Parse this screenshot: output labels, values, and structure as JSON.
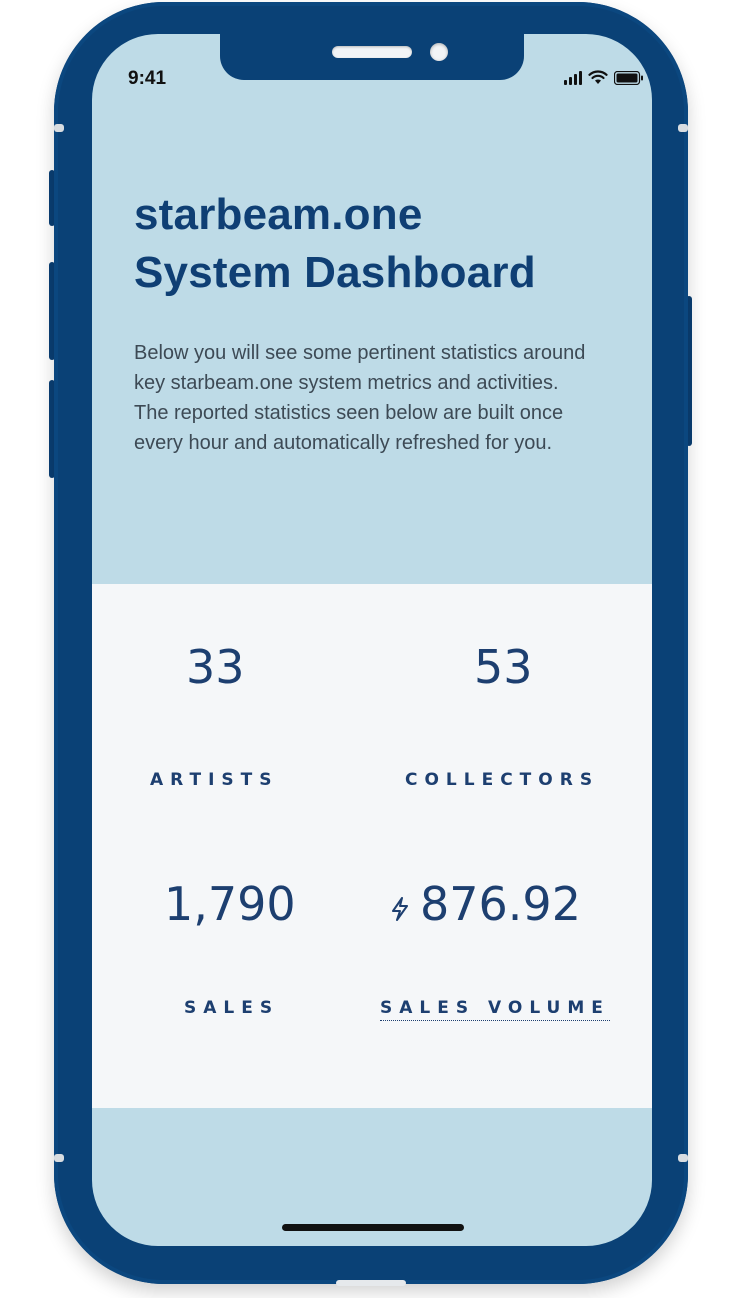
{
  "status_bar": {
    "time": "9:41"
  },
  "hero": {
    "title_line1": "starbeam.one",
    "title_line2": "System Dashboard",
    "intro": "Below you will see some pertinent statistics around key starbeam.one system metrics and activities. The reported statistics seen below are built once every hour and automatically refreshed for you."
  },
  "stats": {
    "artists": {
      "value": "33",
      "label": "ARTISTS"
    },
    "collectors": {
      "value": "53",
      "label": "COLLECTORS"
    },
    "sales": {
      "value": "1,790",
      "label": "SALES"
    },
    "sales_volume": {
      "value": "876.92",
      "label": "SALES VOLUME",
      "currency_icon": "bolt-icon"
    }
  },
  "colors": {
    "frame": "#0a4176",
    "hero_bg": "#bedbe7",
    "stats_bg": "#f5f7f9",
    "title": "#0f3f74",
    "stat_text": "#1d3f70"
  }
}
